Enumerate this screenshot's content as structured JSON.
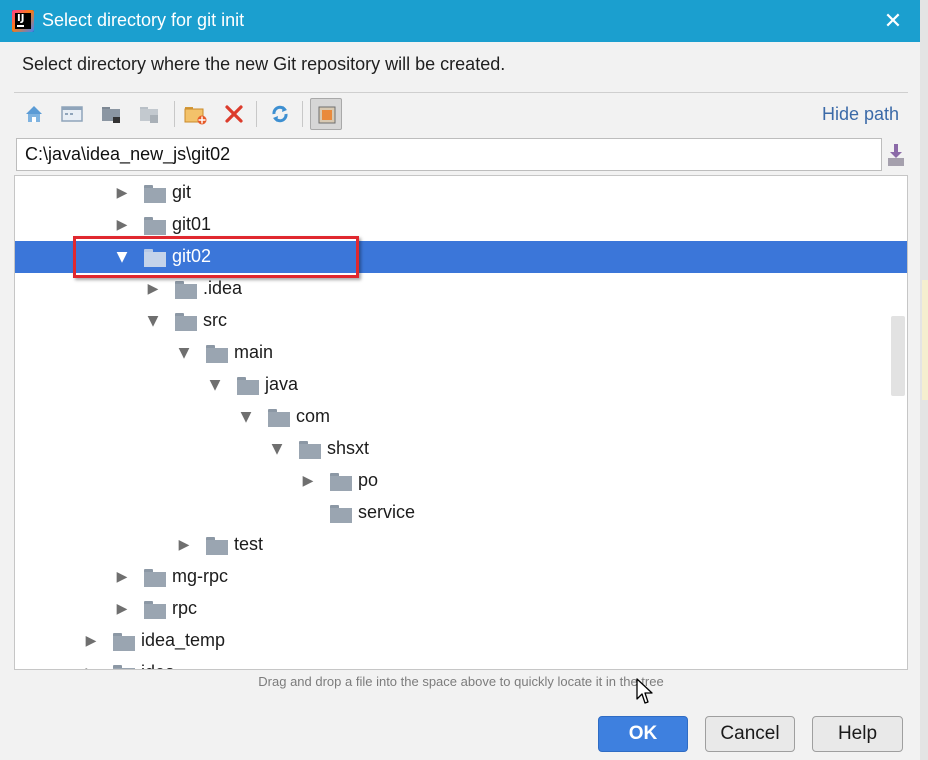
{
  "window": {
    "title": "Select directory for git init",
    "close_glyph": "✕"
  },
  "description": "Select directory where the new Git repository will be created.",
  "toolbar": {
    "buttons": [
      {
        "icon": "home-icon"
      },
      {
        "icon": "desktop-icon"
      },
      {
        "icon": "project-folder-icon"
      },
      {
        "icon": "module-folder-icon"
      },
      {
        "icon": "new-folder-icon"
      },
      {
        "icon": "delete-icon"
      },
      {
        "icon": "refresh-icon"
      },
      {
        "icon": "show-hidden-files-icon"
      }
    ],
    "hide_path_label": "Hide path"
  },
  "path": {
    "value": "C:\\java\\idea_new_js\\git02"
  },
  "tree": {
    "rows": [
      {
        "label": "git",
        "expanded": false
      },
      {
        "label": "git01",
        "expanded": false
      },
      {
        "label": "git02",
        "expanded": true,
        "selected": true
      },
      {
        "label": ".idea",
        "expanded": false
      },
      {
        "label": "src",
        "expanded": true
      },
      {
        "label": "main",
        "expanded": true
      },
      {
        "label": "java",
        "expanded": true
      },
      {
        "label": "com",
        "expanded": true
      },
      {
        "label": "shsxt",
        "expanded": true
      },
      {
        "label": "po",
        "expanded": false
      },
      {
        "label": "service",
        "leaf": true
      },
      {
        "label": "test",
        "expanded": false
      },
      {
        "label": "mg-rpc",
        "expanded": false
      },
      {
        "label": "rpc",
        "expanded": false
      },
      {
        "label": "idea_temp",
        "expanded": false
      },
      {
        "label": "idea_...",
        "expanded": false
      }
    ],
    "arrow_collapsed": "▶",
    "arrow_expanded": "▼"
  },
  "hint": "Drag and drop a file into the space above to quickly locate it in the tree",
  "buttons": {
    "ok": "OK",
    "cancel": "Cancel",
    "help": "Help"
  },
  "colors": {
    "titlebar": "#1b9fcf",
    "selection": "#3b76d9",
    "ok_button": "#3e80df",
    "highlight_box": "#e0282f",
    "hide_path_link": "#3b6aa8"
  }
}
